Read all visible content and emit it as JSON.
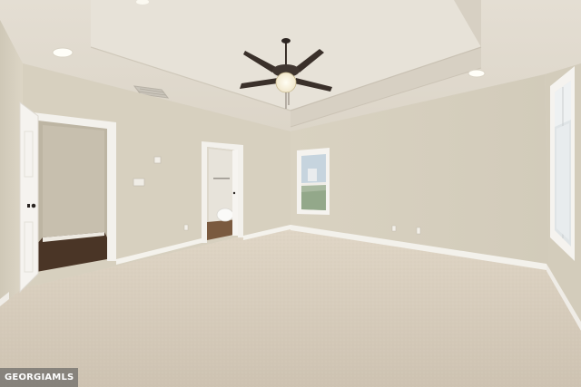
{
  "watermark": {
    "label": "GEORGIAMLS"
  },
  "colors": {
    "wall": "#d9d2c2",
    "ceiling": "#e3ddd2",
    "carpet": "#d6cbbb",
    "trim": "#f4f2ee",
    "hardwood": "#4a3526",
    "fan": "#3a302a"
  }
}
